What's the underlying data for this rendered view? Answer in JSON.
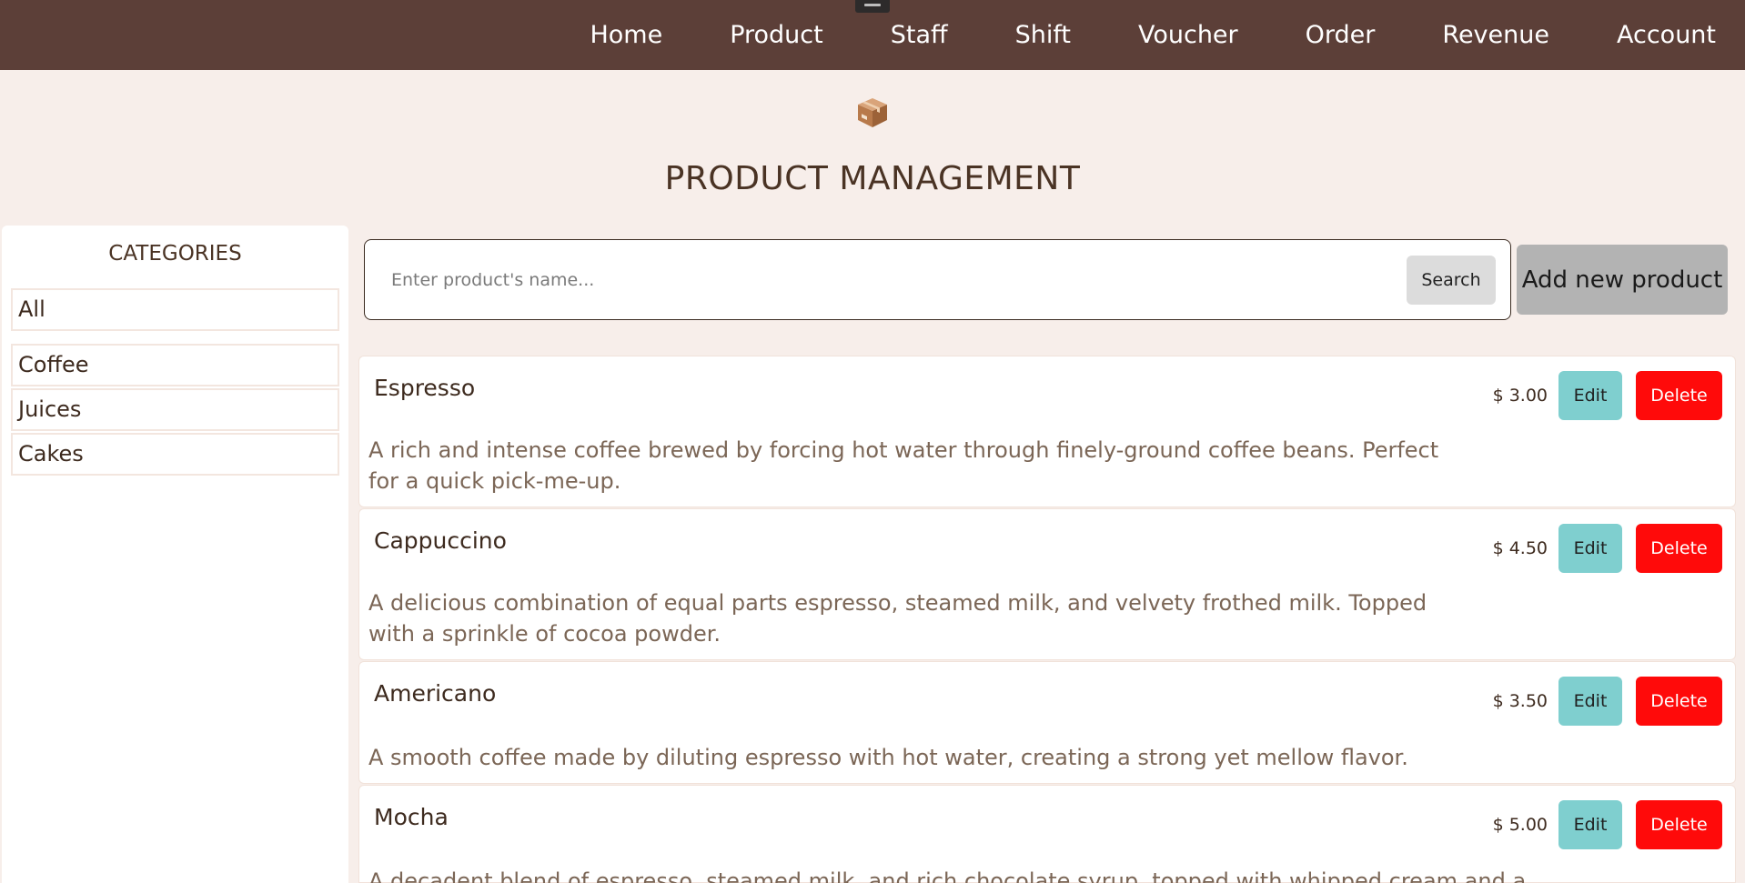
{
  "nav": {
    "items": [
      {
        "label": "Home"
      },
      {
        "label": "Product"
      },
      {
        "label": "Staff"
      },
      {
        "label": "Shift"
      },
      {
        "label": "Voucher"
      },
      {
        "label": "Order"
      },
      {
        "label": "Revenue"
      },
      {
        "label": "Account"
      }
    ]
  },
  "header": {
    "icon": "package-box-icon",
    "title": "PRODUCT MANAGEMENT"
  },
  "sidebar": {
    "title": "CATEGORIES",
    "items": [
      {
        "label": "All"
      },
      {
        "label": "Coffee"
      },
      {
        "label": "Juices"
      },
      {
        "label": "Cakes"
      }
    ]
  },
  "search": {
    "placeholder": "Enter product's name...",
    "value": "",
    "button_label": "Search"
  },
  "actions": {
    "add_label": "Add new product"
  },
  "products": [
    {
      "name": "Espresso",
      "description": "A rich and intense coffee brewed by forcing hot water through finely-ground coffee beans. Perfect for a quick pick-me-up.",
      "price": "$ 3.00",
      "edit_label": "Edit",
      "delete_label": "Delete"
    },
    {
      "name": "Cappuccino",
      "description": "A delicious combination of equal parts espresso, steamed milk, and velvety frothed milk. Topped with a sprinkle of cocoa powder.",
      "price": "$ 4.50",
      "edit_label": "Edit",
      "delete_label": "Delete"
    },
    {
      "name": "Americano",
      "description": "A smooth coffee made by diluting espresso with hot water, creating a strong yet mellow flavor.",
      "price": "$ 3.50",
      "edit_label": "Edit",
      "delete_label": "Delete"
    },
    {
      "name": "Mocha",
      "description": "A decadent blend of espresso, steamed milk, and rich chocolate syrup, topped with whipped cream and a",
      "price": "$ 5.00",
      "edit_label": "Edit",
      "delete_label": "Delete"
    }
  ],
  "colors": {
    "navbar": "#5c3f38",
    "background": "#f7eeea",
    "edit": "#7fcfcf",
    "delete": "#ff0a0a",
    "add": "#b3b3b3"
  }
}
